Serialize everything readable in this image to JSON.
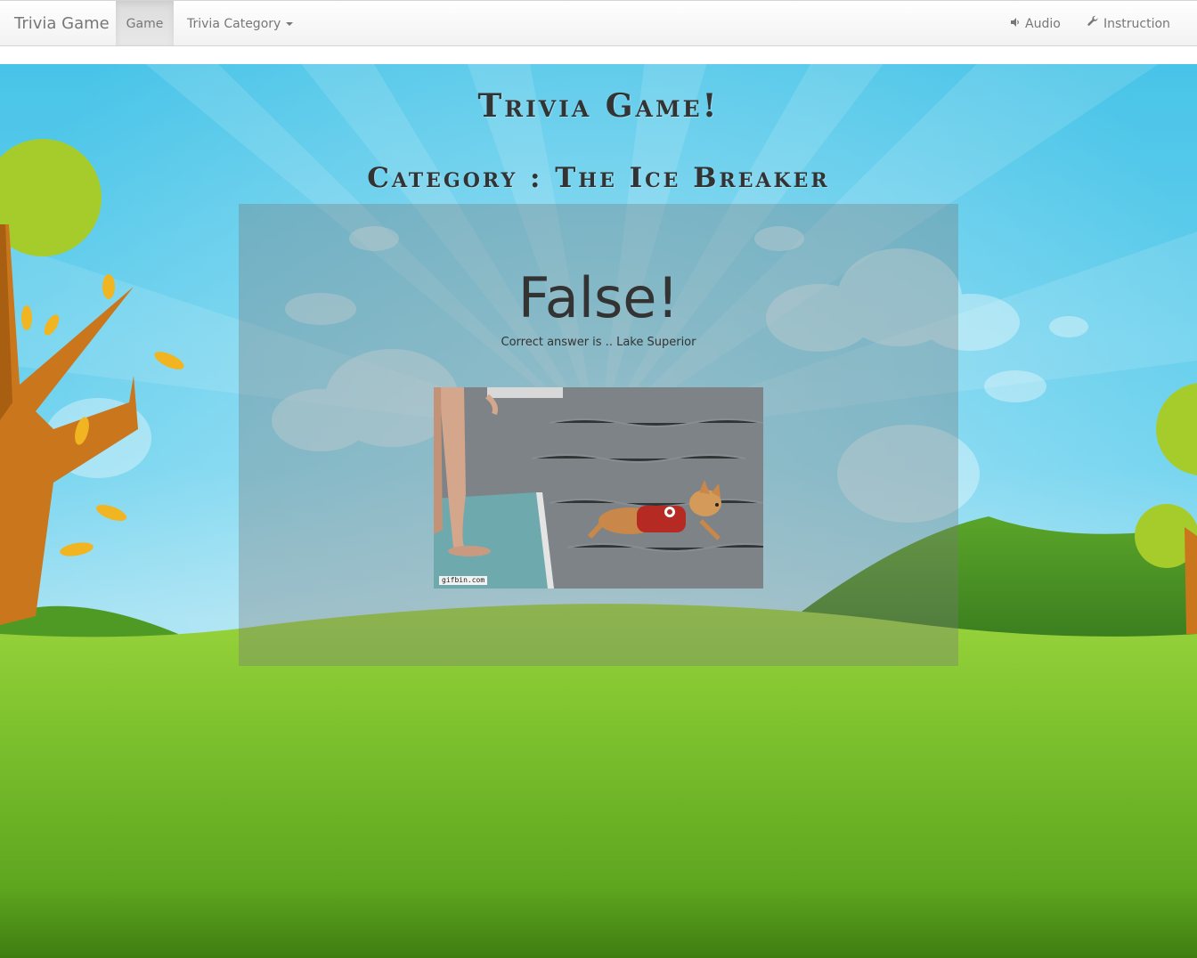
{
  "navbar": {
    "brand": "Trivia Game",
    "game_label": "Game",
    "category_label": "Trivia Category",
    "audio_label": "Audio",
    "instruction_label": "Instruction"
  },
  "header": {
    "title": "Trivia Game!",
    "category": "Category : The Ice Breaker"
  },
  "result": {
    "verdict": "False!",
    "correct_answer": "Correct answer is .. Lake Superior",
    "gif_watermark": "gifbin.com"
  },
  "colors": {
    "sky": "#48c4e8",
    "grass": "#7dc22e",
    "panel": "#787878"
  }
}
